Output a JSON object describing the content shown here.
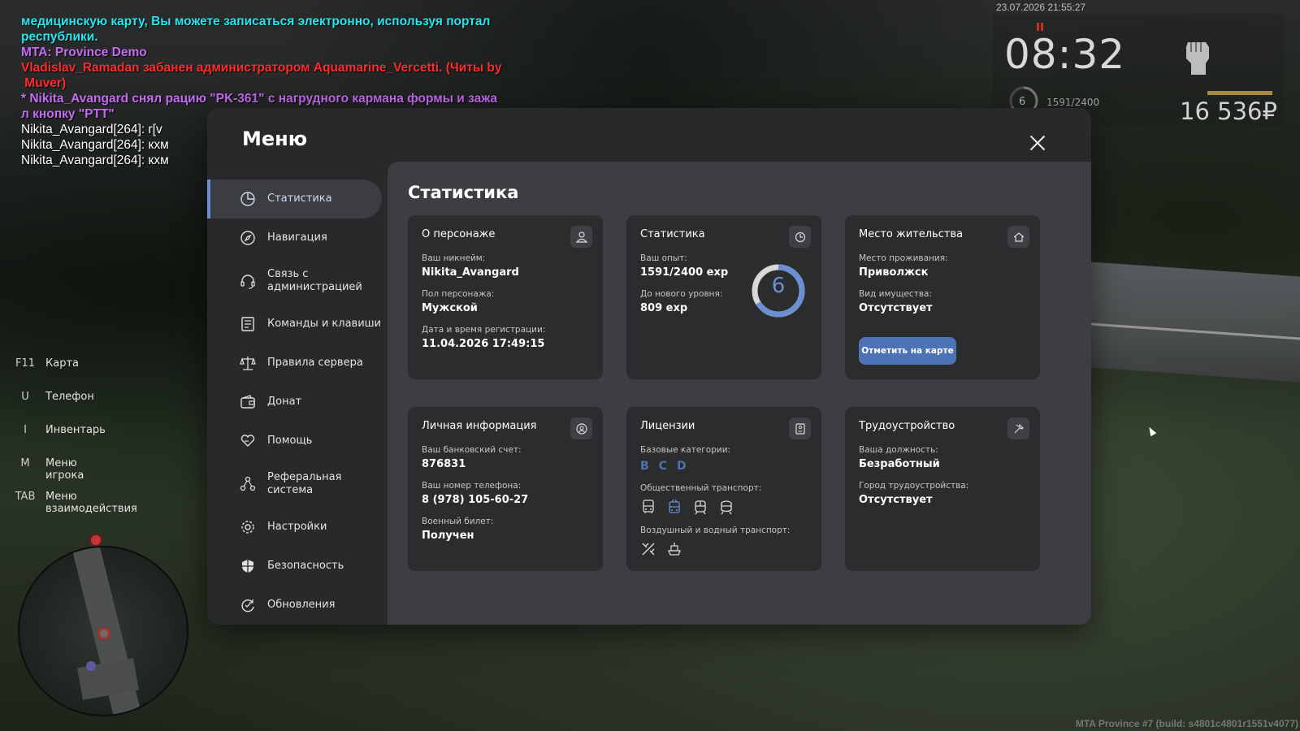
{
  "chat": {
    "line1": "медицинскую карту, Вы можете записаться электронно, используя портал",
    "line2": "республики.",
    "line3": "MTA: Province Demo",
    "line4": "Vladislav_Ramadan забанен администратором Aquamarine_Vercetti. (Читы by",
    "line5": " Muver)",
    "line6": "* Nikita_Avangard снял рацию \"PK-361\" с нагрудного кармана формы и зажа",
    "line7": "л кнопку \"PTT\"",
    "line8": "Nikita_Avangard[264]: r[v",
    "line9": "Nikita_Avangard[264]: кхм",
    "line10": "Nikita_Avangard[264]: кхм"
  },
  "hud": {
    "datetime": "23.07.2026 21:55:27",
    "time": "08:32",
    "level": "6",
    "exp": "1591/2400",
    "money": "16 536₽"
  },
  "hints": [
    {
      "key": "F11",
      "label": "Карта"
    },
    {
      "key": "U",
      "label": "Телефон"
    },
    {
      "key": "I",
      "label": "Инвентарь"
    },
    {
      "key": "M",
      "label": "Меню игрока"
    },
    {
      "key": "TAB",
      "label": "Меню взаимодействия"
    }
  ],
  "build": "MTA Province #7 (build: s4801c4801r1551v4077)",
  "menu": {
    "title": "Меню",
    "nav": [
      {
        "label": "Статистика",
        "icon": "pie-chart-icon",
        "active": true
      },
      {
        "label": "Навигация",
        "icon": "compass-icon"
      },
      {
        "label": "Связь с администрацией",
        "icon": "headset-icon"
      },
      {
        "label": "Команды и клавиши",
        "icon": "document-list-icon"
      },
      {
        "label": "Правила сервера",
        "icon": "scales-icon"
      },
      {
        "label": "Донат",
        "icon": "wallet-icon"
      },
      {
        "label": "Помощь",
        "icon": "heart-hands-icon"
      },
      {
        "label": "Реферальная система",
        "icon": "referral-network-icon"
      },
      {
        "label": "Настройки",
        "icon": "gear-icon"
      },
      {
        "label": "Безопасность",
        "icon": "shield-icon"
      },
      {
        "label": "Обновления",
        "icon": "refresh-check-icon"
      }
    ]
  },
  "stats": {
    "title": "Статистика",
    "character": {
      "title": "О персонаже",
      "nickname_label": "Ваш никнейм:",
      "nickname": "Nikita_Avangard",
      "gender_label": "Пол персонажа:",
      "gender": "Мужской",
      "regdate_label": "Дата и время регистрации:",
      "regdate": "11.04.2026 17:49:15"
    },
    "statistics": {
      "title": "Статистика",
      "exp_label": "Ваш опыт:",
      "exp": "1591/2400 exp",
      "next_label": "До нового уровня:",
      "next": "809 exp",
      "level": "6",
      "progress": 0.663,
      "ring_color": "#6c8fd1"
    },
    "residence": {
      "title": "Место жительства",
      "place_label": "Место проживания:",
      "place": "Приволжск",
      "property_label": "Вид имущества:",
      "property": "Отсутствует",
      "button": "Отметить на карте"
    },
    "personal": {
      "title": "Личная информация",
      "bank_label": "Ваш банковский счет:",
      "bank": "876831",
      "phone_label": "Ваш номер телефона:",
      "phone": "8 (978) 105-60-27",
      "military_label": "Военный билет:",
      "military": "Получен"
    },
    "licenses": {
      "title": "Лицензии",
      "base_label": "Базовые категории:",
      "categories": [
        "B",
        "C",
        "D"
      ],
      "public_label": "Общественный транспорт:",
      "public_icons": [
        "bus-icon",
        "trolleybus-icon",
        "tram-icon",
        "metro-icon"
      ],
      "air_label": "Воздушный и водный транспорт:",
      "air_icons": [
        "airplane-icon",
        "boat-icon"
      ]
    },
    "employment": {
      "title": "Трудоустройство",
      "position_label": "Ваша должность:",
      "position": "Безработный",
      "city_label": "Город трудоустройства:",
      "city": "Отсутствует"
    }
  }
}
